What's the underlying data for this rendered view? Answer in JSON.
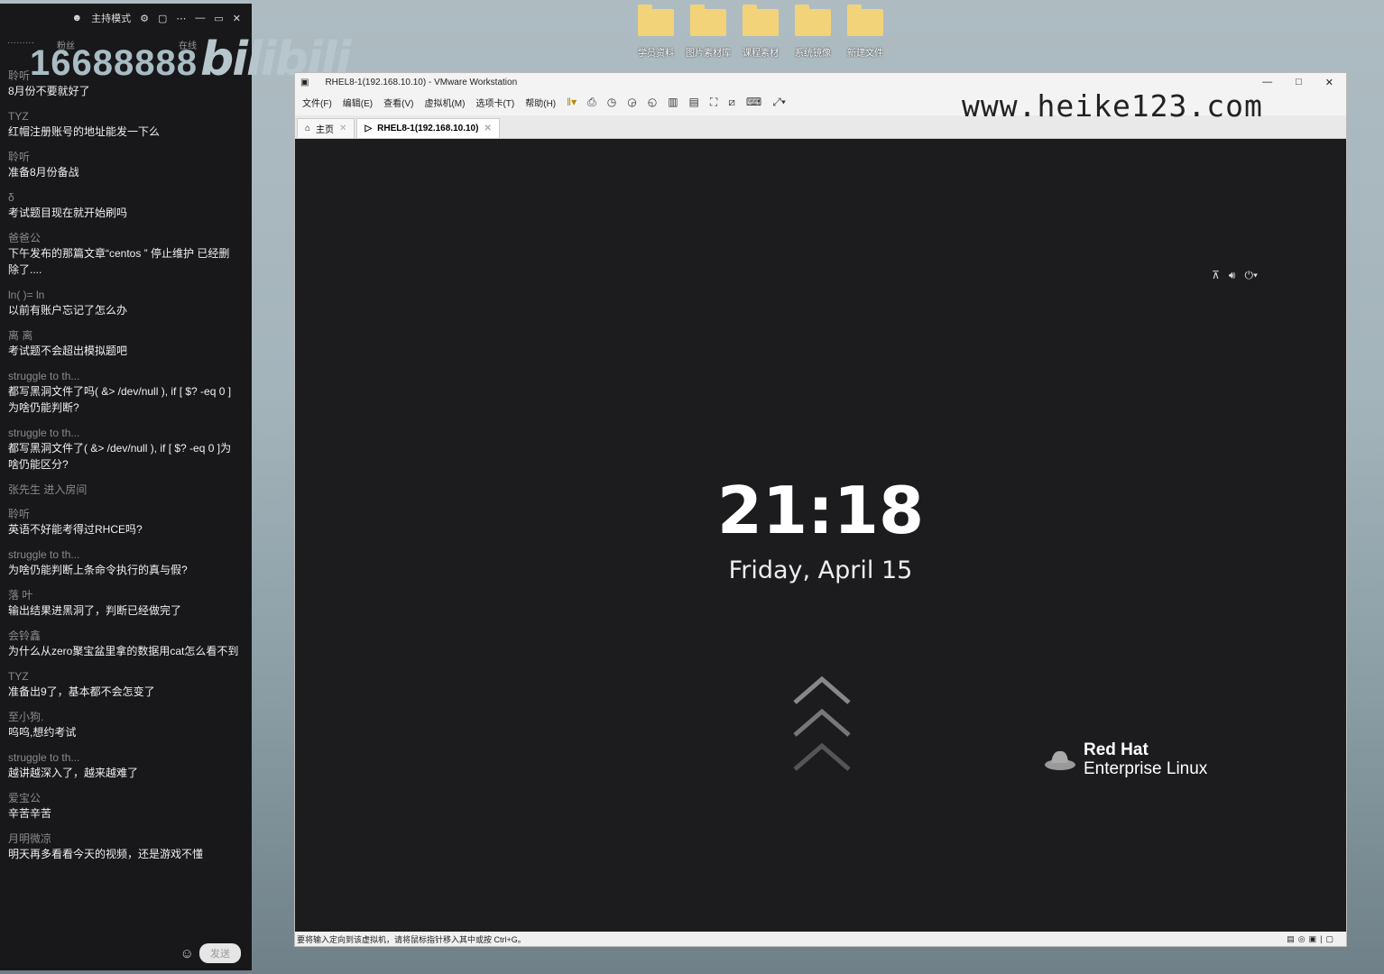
{
  "desktop": {
    "icons": [
      {
        "label": "学员资料"
      },
      {
        "label": "图片素材库"
      },
      {
        "label": "课程素材"
      },
      {
        "label": "系统镜像"
      },
      {
        "label": "新建文件"
      }
    ]
  },
  "chat": {
    "header": {
      "mode_label": "主持模式",
      "sub_left": "·········",
      "sub_mid": "粉丝",
      "sub_right": "在线"
    },
    "overlay_number": "16688888",
    "overlay_logo": "bilibili",
    "messages": [
      {
        "user": "聆听",
        "text": "8月份不要就好了"
      },
      {
        "user": "TYZ",
        "text": "红帽注册账号的地址能发一下么"
      },
      {
        "user": "聆听",
        "text": "准备8月份备战"
      },
      {
        "user": "δ",
        "text": "考试题目现在就开始刷吗"
      },
      {
        "user": "爸爸公",
        "text": "下午发布的那篇文章“centos ” 停止维护 已经删除了...."
      },
      {
        "user": "ln(  )=  ln",
        "text": "以前有账户忘记了怎么办"
      },
      {
        "user": "离 离",
        "text": "考试题不会超出模拟题吧"
      },
      {
        "user": "struggle to th...",
        "text": "都写黑洞文件了吗( &> /dev/null ), if [ $? -eq 0 ]为啥仍能判断?"
      },
      {
        "user": "struggle to th...",
        "text": "都写黑洞文件了( &> /dev/null ), if [ $? -eq 0 ]为啥仍能区分?"
      },
      {
        "user": "",
        "text": "",
        "system": "张先生 进入房间"
      },
      {
        "user": "聆听",
        "text": "英语不好能考得过RHCE吗?"
      },
      {
        "user": "struggle to th...",
        "text": "为啥仍能判断上条命令执行的真与假?"
      },
      {
        "user": "  落  叶",
        "text": "输出结果进黑洞了，判断已经做完了"
      },
      {
        "user": "会铃鑫",
        "text": "为什么从zero聚宝盆里拿的数据用cat怎么看不到"
      },
      {
        "user": "TYZ",
        "text": "准备出9了，基本都不会怎变了"
      },
      {
        "user": "至小狗.",
        "text": "呜呜,想约考试"
      },
      {
        "user": "struggle to th...",
        "text": "越讲越深入了，越来越难了"
      },
      {
        "user": "爱宝公",
        "text": "辛苦辛苦"
      },
      {
        "user": "月明微凉",
        "text": "明天再多看看今天的视频，还是游戏不懂"
      }
    ],
    "send_label": "发送"
  },
  "vmware": {
    "title": "RHEL8-1(192.168.10.10) - VMware Workstation",
    "menu": [
      "文件(F)",
      "编辑(E)",
      "查看(V)",
      "虚拟机(M)",
      "选项卡(T)",
      "帮助(H)"
    ],
    "tabs": [
      {
        "label": "主页"
      },
      {
        "label": "RHEL8-1(192.168.10.10)"
      }
    ],
    "lock_screen": {
      "time": "21:18",
      "date": "Friday, April 15",
      "brand_line1": "Red Hat",
      "brand_line2": "Enterprise Linux"
    },
    "status_text": "要将输入定向到该虚拟机，请将鼠标指针移入其中或按 Ctrl+G。"
  },
  "watermark": "www.heike123.com"
}
